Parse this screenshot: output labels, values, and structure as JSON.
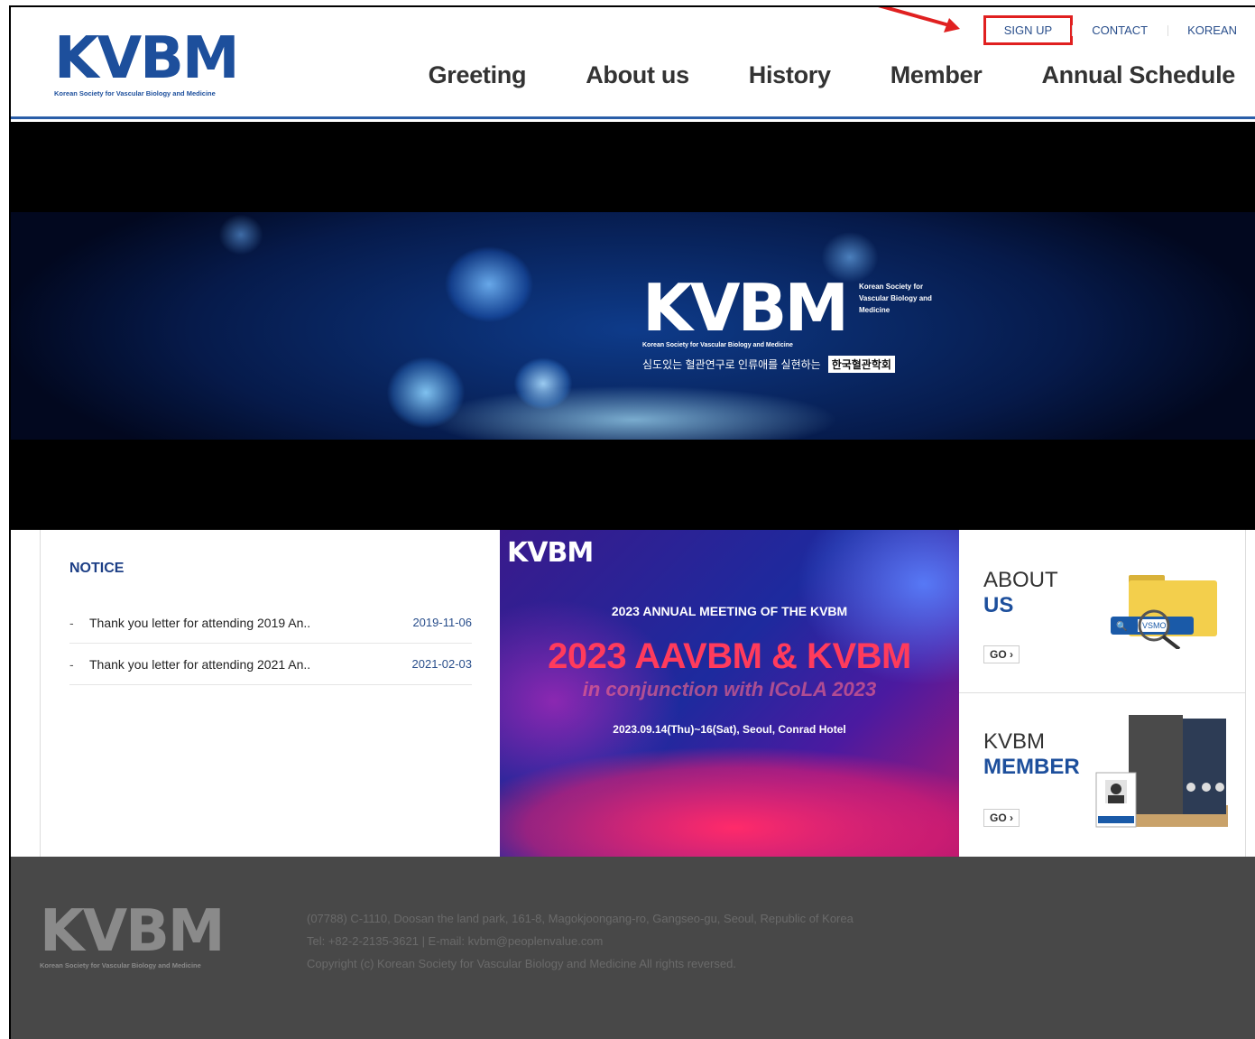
{
  "header": {
    "logo_text": "KVBM",
    "logo_tagline": "Korean Society for Vascular Biology and Medicine",
    "util_links": [
      "SIGN UP",
      "CONTACT",
      "KOREAN"
    ],
    "nav": [
      "Greeting",
      "About us",
      "History",
      "Member",
      "Annual Schedule"
    ]
  },
  "hero": {
    "logo_text": "KVBM",
    "logo_tagline": "Korean Society for Vascular Biology and Medicine",
    "side_text": "Korean Society for Vascular Biology and Medicine",
    "korean_slogan": "심도있는 혈관연구로 인류애를 실현하는",
    "korean_name": "한국혈관학회"
  },
  "notice": {
    "title": "NOTICE",
    "items": [
      {
        "title": "Thank you letter for attending 2019 An..",
        "date": "2019-11-06"
      },
      {
        "title": "Thank you letter for attending 2021 An..",
        "date": "2021-02-03"
      }
    ]
  },
  "promo": {
    "logo_text": "KVBM",
    "subtitle": "2023 ANNUAL MEETING OF THE KVBM",
    "headline": "2023 AAVBM & KVBM",
    "conjunction": "in conjunction with ICoLA 2023",
    "date": "2023.09.14(Thu)~16(Sat), Seoul, Conrad Hotel"
  },
  "about": {
    "line1": "ABOUT",
    "line2": "US",
    "go": "GO ›",
    "folder_label": "VSMO"
  },
  "member": {
    "line1": "KVBM",
    "line2": "MEMBER",
    "go": "GO ›"
  },
  "footer": {
    "logo_text": "KVBM",
    "logo_tagline": "Korean Society for Vascular Biology and Medicine",
    "address": "(07788) C-1110, Doosan the land park, 161-8, Magokjoongang-ro, Gangseo-gu, Seoul, Republic of Korea",
    "contact": "Tel: +82-2-2135-3621 | E-mail: kvbm@peoplenvalue.com",
    "copyright": "Copyright (c) Korean Society for Vascular Biology and Medicine All rights reversed."
  },
  "colors": {
    "brand_blue": "#1d4f9c",
    "brand_red": "#c8202e",
    "highlight": "#e02020",
    "footer_bg": "#484848"
  }
}
